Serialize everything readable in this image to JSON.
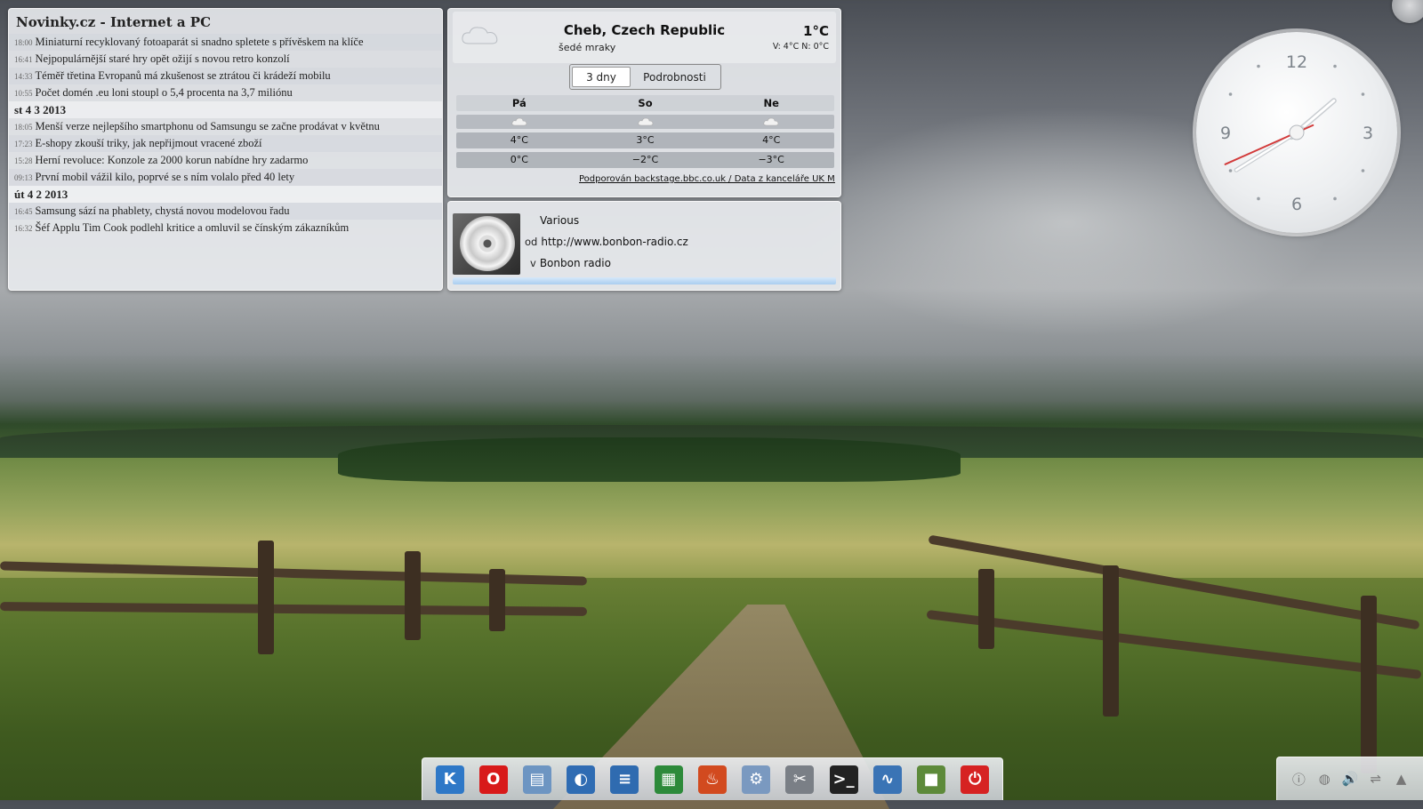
{
  "news": {
    "title": "Novinky.cz - Internet a PC",
    "rows": [
      {
        "time": "18:00",
        "text": "Miniaturní recyklovaný fotoaparát si snadno spletete s přívěskem na klíče"
      },
      {
        "time": "16:41",
        "text": "Nejpopulárnější staré hry opět ožijí s novou retro konzolí"
      },
      {
        "time": "14:33",
        "text": "Téměř třetina Evropanů má zkušenost se ztrátou či krádeží mobilu"
      },
      {
        "time": "10:55",
        "text": "Počet domén .eu loni stoupl o 5,4 procenta na 3,7 miliónu"
      },
      {
        "date": "st 4 3 2013"
      },
      {
        "time": "18:05",
        "text": "Menší verze nejlepšího smartphonu od Samsungu se začne prodávat v květnu"
      },
      {
        "time": "17:23",
        "text": "E-shopy zkouší triky, jak nepřijmout vracené zboží"
      },
      {
        "time": "15:28",
        "text": "Herní revoluce: Konzole za 2000 korun nabídne hry zadarmo"
      },
      {
        "time": "09:13",
        "text": "První mobil vážil kilo, poprvé se s ním volalo před 40 lety"
      },
      {
        "date": "út 4 2 2013"
      },
      {
        "time": "16:45",
        "text": "Samsung sází na phablety, chystá novou modelovou řadu"
      },
      {
        "time": "16:32",
        "text": "Šéf Applu Tim Cook podlehl kritice a omluvil se čínským zákazníkům"
      }
    ]
  },
  "weather": {
    "location": "Cheb, Czech Republic",
    "condition": "šedé mraky",
    "temp": "1°C",
    "highlow": "V: 4°C N: 0°C",
    "tabs": [
      "3 dny",
      "Podrobnosti"
    ],
    "days": [
      "Pá",
      "So",
      "Ne"
    ],
    "highs": [
      "4°C",
      "3°C",
      "4°C"
    ],
    "lows": [
      "0°C",
      "−2°C",
      "−3°C"
    ],
    "credit": "Podporován backstage.bbc.co.uk / Data z kanceláře UK MET",
    "icon": "cloud-icon"
  },
  "player": {
    "artist": "Various",
    "from_prefix": "od",
    "url": "http://www.bonbon-radio.cz",
    "in_prefix": "v",
    "station": "Bonbon radio"
  },
  "clock": {
    "numerals": [
      "12",
      "3",
      "6",
      "9"
    ],
    "hour": 1,
    "minute": 39,
    "second": 41
  },
  "taskbar": {
    "icons": [
      {
        "name": "kde-launcher-icon",
        "glyph": "K",
        "bg": "#2e78c7"
      },
      {
        "name": "opera-icon",
        "glyph": "O",
        "bg": "#d81a1a"
      },
      {
        "name": "file-manager-icon",
        "glyph": "▤",
        "bg": "#6d95c2"
      },
      {
        "name": "web-browser-icon",
        "glyph": "◐",
        "bg": "#2f6cb3"
      },
      {
        "name": "writer-icon",
        "glyph": "≡",
        "bg": "#2f6bb0"
      },
      {
        "name": "calc-icon",
        "glyph": "▦",
        "bg": "#2d8a3a"
      },
      {
        "name": "burner-icon",
        "glyph": "♨",
        "bg": "#d24a1f"
      },
      {
        "name": "package-manager-icon",
        "glyph": "⚙",
        "bg": "#7a99c0"
      },
      {
        "name": "settings-tools-icon",
        "glyph": "✂",
        "bg": "#7a7f86"
      },
      {
        "name": "terminal-icon",
        "glyph": ">_",
        "bg": "#222222"
      },
      {
        "name": "system-monitor-icon",
        "glyph": "∿",
        "bg": "#3a74b5"
      },
      {
        "name": "minecraft-icon",
        "glyph": "■",
        "bg": "#5d8a3a"
      },
      {
        "name": "power-icon",
        "glyph": "⏻",
        "bg": "#d62222"
      }
    ]
  },
  "tray": {
    "icons": [
      {
        "name": "info-icon",
        "glyph": "ⓘ"
      },
      {
        "name": "network-globe-icon",
        "glyph": "◍"
      },
      {
        "name": "volume-icon",
        "glyph": "🔊"
      },
      {
        "name": "usb-icon",
        "glyph": "⇌"
      },
      {
        "name": "tray-expand-icon",
        "glyph": "▲"
      }
    ]
  }
}
